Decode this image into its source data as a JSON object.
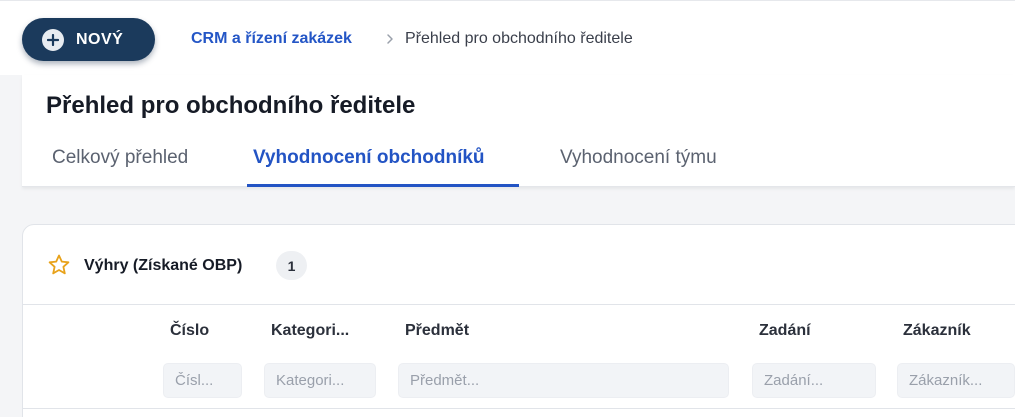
{
  "toolbar": {
    "new_label": "NOVÝ"
  },
  "breadcrumb": {
    "parent": "CRM a řízení zakázek",
    "current": "Přehled pro obchodního ředitele"
  },
  "page": {
    "title": "Přehled pro obchodního ředitele"
  },
  "tabs": [
    {
      "label": "Celkový přehled",
      "active": false
    },
    {
      "label": "Vyhodnocení obchodníků",
      "active": true
    },
    {
      "label": "Vyhodnocení týmu",
      "active": false
    }
  ],
  "panel": {
    "icon": "star-icon",
    "title": "Výhry (Získané OBP)",
    "count": "1"
  },
  "table": {
    "columns": [
      {
        "header": "Číslo",
        "filter_placeholder": "Čísl..."
      },
      {
        "header": "Kategori...",
        "filter_placeholder": "Kategori..."
      },
      {
        "header": "Předmět",
        "filter_placeholder": "Předmět..."
      },
      {
        "header": "Zadání",
        "filter_placeholder": "Zadání..."
      },
      {
        "header": "Zákazník",
        "filter_placeholder": "Zákazník..."
      }
    ]
  },
  "colors": {
    "brand_dark": "#1b3a5c",
    "accent": "#2354c4",
    "star": "#e8a21a"
  }
}
